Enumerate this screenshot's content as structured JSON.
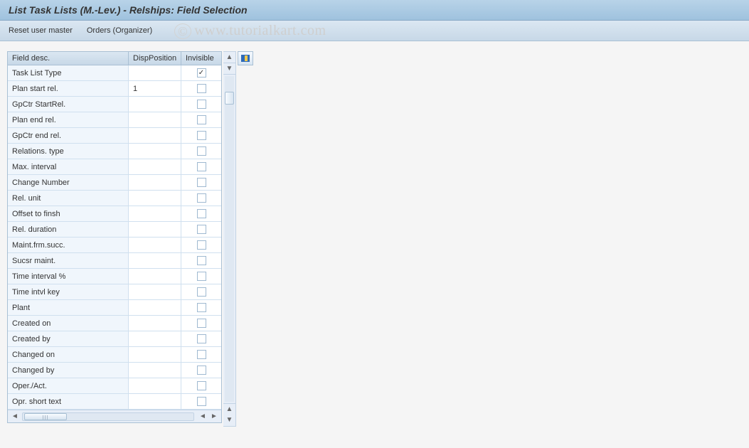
{
  "header": {
    "title": "List Task Lists (M.-Lev.) - Relships: Field Selection"
  },
  "toolbar": {
    "reset_user_master": "Reset user master",
    "orders_organizer": "Orders (Organizer)"
  },
  "table": {
    "columns": {
      "field_desc": "Field desc.",
      "disp_position": "DispPosition",
      "invisible": "Invisible"
    },
    "rows": [
      {
        "field_desc": "Task List Type",
        "disp_position": "",
        "invisible": true
      },
      {
        "field_desc": "Plan start rel.",
        "disp_position": "1",
        "invisible": false
      },
      {
        "field_desc": "GpCtr StartRel.",
        "disp_position": "",
        "invisible": false
      },
      {
        "field_desc": "Plan end rel.",
        "disp_position": "",
        "invisible": false
      },
      {
        "field_desc": "GpCtr end rel.",
        "disp_position": "",
        "invisible": false
      },
      {
        "field_desc": "Relations. type",
        "disp_position": "",
        "invisible": false
      },
      {
        "field_desc": "Max. interval",
        "disp_position": "",
        "invisible": false
      },
      {
        "field_desc": "Change Number",
        "disp_position": "",
        "invisible": false
      },
      {
        "field_desc": "Rel. unit",
        "disp_position": "",
        "invisible": false
      },
      {
        "field_desc": "Offset to finsh",
        "disp_position": "",
        "invisible": false
      },
      {
        "field_desc": "Rel. duration",
        "disp_position": "",
        "invisible": false
      },
      {
        "field_desc": "Maint.frm.succ.",
        "disp_position": "",
        "invisible": false
      },
      {
        "field_desc": "Sucsr maint.",
        "disp_position": "",
        "invisible": false
      },
      {
        "field_desc": "Time interval %",
        "disp_position": "",
        "invisible": false
      },
      {
        "field_desc": "Time intvl key",
        "disp_position": "",
        "invisible": false
      },
      {
        "field_desc": "Plant",
        "disp_position": "",
        "invisible": false
      },
      {
        "field_desc": "Created on",
        "disp_position": "",
        "invisible": false
      },
      {
        "field_desc": "Created by",
        "disp_position": "",
        "invisible": false
      },
      {
        "field_desc": "Changed on",
        "disp_position": "",
        "invisible": false
      },
      {
        "field_desc": "Changed by",
        "disp_position": "",
        "invisible": false
      },
      {
        "field_desc": "Oper./Act.",
        "disp_position": "",
        "invisible": false
      },
      {
        "field_desc": "Opr. short text",
        "disp_position": "",
        "invisible": false
      }
    ]
  },
  "watermark": {
    "text": "www.tutorialkart.com",
    "copy": "©"
  }
}
